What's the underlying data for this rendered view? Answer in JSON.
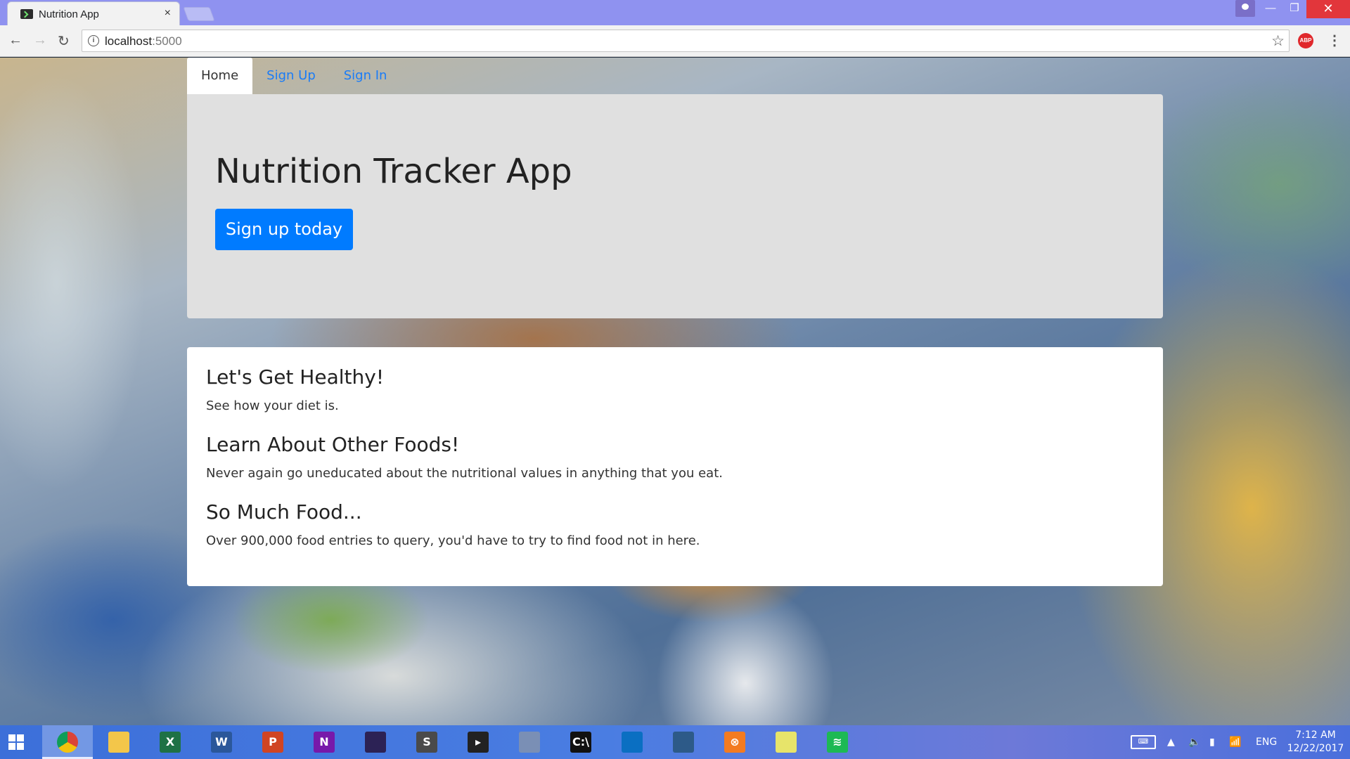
{
  "browser": {
    "tab_title": "Nutrition App",
    "tab_close": "×",
    "url_host": "localhost",
    "url_port": ":5000",
    "abp_label": "ABP",
    "window_min": "—",
    "window_max": "❐",
    "window_close": "✕"
  },
  "nav": {
    "tabs": [
      {
        "label": "Home",
        "active": true
      },
      {
        "label": "Sign Up",
        "active": false
      },
      {
        "label": "Sign In",
        "active": false
      }
    ]
  },
  "jumbotron": {
    "title": "Nutrition Tracker App",
    "cta_label": "Sign up today"
  },
  "features": [
    {
      "heading": "Let's Get Healthy!",
      "text": "See how your diet is."
    },
    {
      "heading": "Learn About Other Foods!",
      "text": "Never again go uneducated about the nutritional values in anything that you eat."
    },
    {
      "heading": "So Much Food...",
      "text": "Over 900,000 food entries to query, you'd have to try to find food not in here."
    }
  ],
  "taskbar": {
    "apps": [
      {
        "name": "chrome-icon",
        "glyph": "",
        "color": "#db4437",
        "active": true
      },
      {
        "name": "file-explorer-icon",
        "glyph": "",
        "color": "#f3c64a",
        "active": false
      },
      {
        "name": "excel-icon",
        "glyph": "X",
        "color": "#1e7145",
        "active": false
      },
      {
        "name": "word-icon",
        "glyph": "W",
        "color": "#2b579a",
        "active": false
      },
      {
        "name": "powerpoint-icon",
        "glyph": "P",
        "color": "#d04423",
        "active": false
      },
      {
        "name": "onenote-icon",
        "glyph": "N",
        "color": "#7719aa",
        "active": false
      },
      {
        "name": "eclipse-icon",
        "glyph": "",
        "color": "#2c2255",
        "active": false
      },
      {
        "name": "sublime-text-icon",
        "glyph": "S",
        "color": "#4a4a4a",
        "active": false
      },
      {
        "name": "terminal-icon",
        "glyph": "▸",
        "color": "#222222",
        "active": false
      },
      {
        "name": "virtualbox-icon",
        "glyph": "",
        "color": "#7a8fb5",
        "active": false
      },
      {
        "name": "command-prompt-icon",
        "glyph": "C:\\",
        "color": "#111111",
        "active": false
      },
      {
        "name": "visual-studio-code-icon",
        "glyph": "",
        "color": "#0a6fc2",
        "active": false
      },
      {
        "name": "mysql-workbench-icon",
        "glyph": "",
        "color": "#2d5a88",
        "active": false
      },
      {
        "name": "xampp-icon",
        "glyph": "⊗",
        "color": "#f37b20",
        "active": false
      },
      {
        "name": "sticky-notes-icon",
        "glyph": "",
        "color": "#e7e46a",
        "active": false
      },
      {
        "name": "spotify-icon",
        "glyph": "≋",
        "color": "#1db954",
        "active": false
      }
    ],
    "language": "ENG",
    "time": "7:12 AM",
    "date": "12/22/2017"
  }
}
